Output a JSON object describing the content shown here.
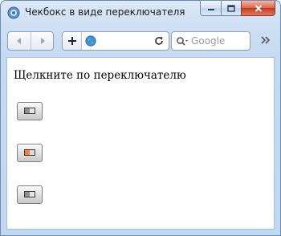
{
  "window": {
    "title": "Чекбокс в виде переключателя"
  },
  "toolbar": {
    "search_placeholder": "Google"
  },
  "page": {
    "heading": "Щелкните по переключателю",
    "switches": [
      {
        "checked": false
      },
      {
        "checked": true
      },
      {
        "checked": false
      }
    ]
  },
  "colors": {
    "switch_on_accent": "#ff7a2a",
    "window_frame": "#c6daf1",
    "close_button": "#c43a1f"
  }
}
